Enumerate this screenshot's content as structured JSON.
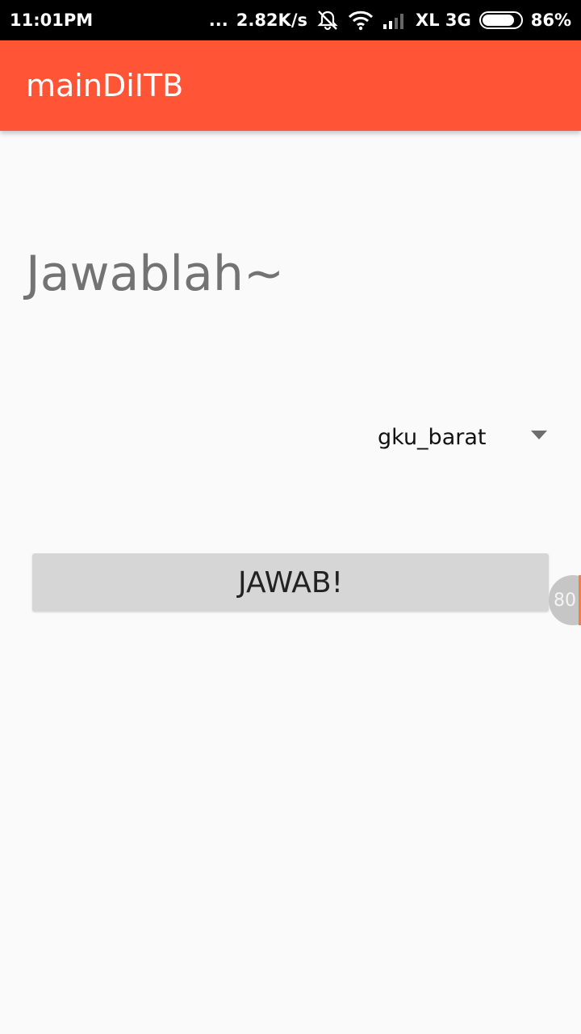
{
  "status_bar": {
    "time": "11:01PM",
    "dots": "...",
    "network_speed": "2.82K/s",
    "carrier": "XL 3G",
    "battery_percent": "86%",
    "battery_level": 0.86,
    "icons": [
      "notifications-off-icon",
      "wifi-icon",
      "signal-icon",
      "battery-icon"
    ]
  },
  "app_bar": {
    "title": "mainDiITB",
    "color": "#ff5436"
  },
  "main": {
    "heading": "Jawablah~",
    "spinner": {
      "selected_value": "gku_barat"
    },
    "answer_button_label": "JAWAB!"
  },
  "floating_bubble": {
    "label": "80"
  }
}
